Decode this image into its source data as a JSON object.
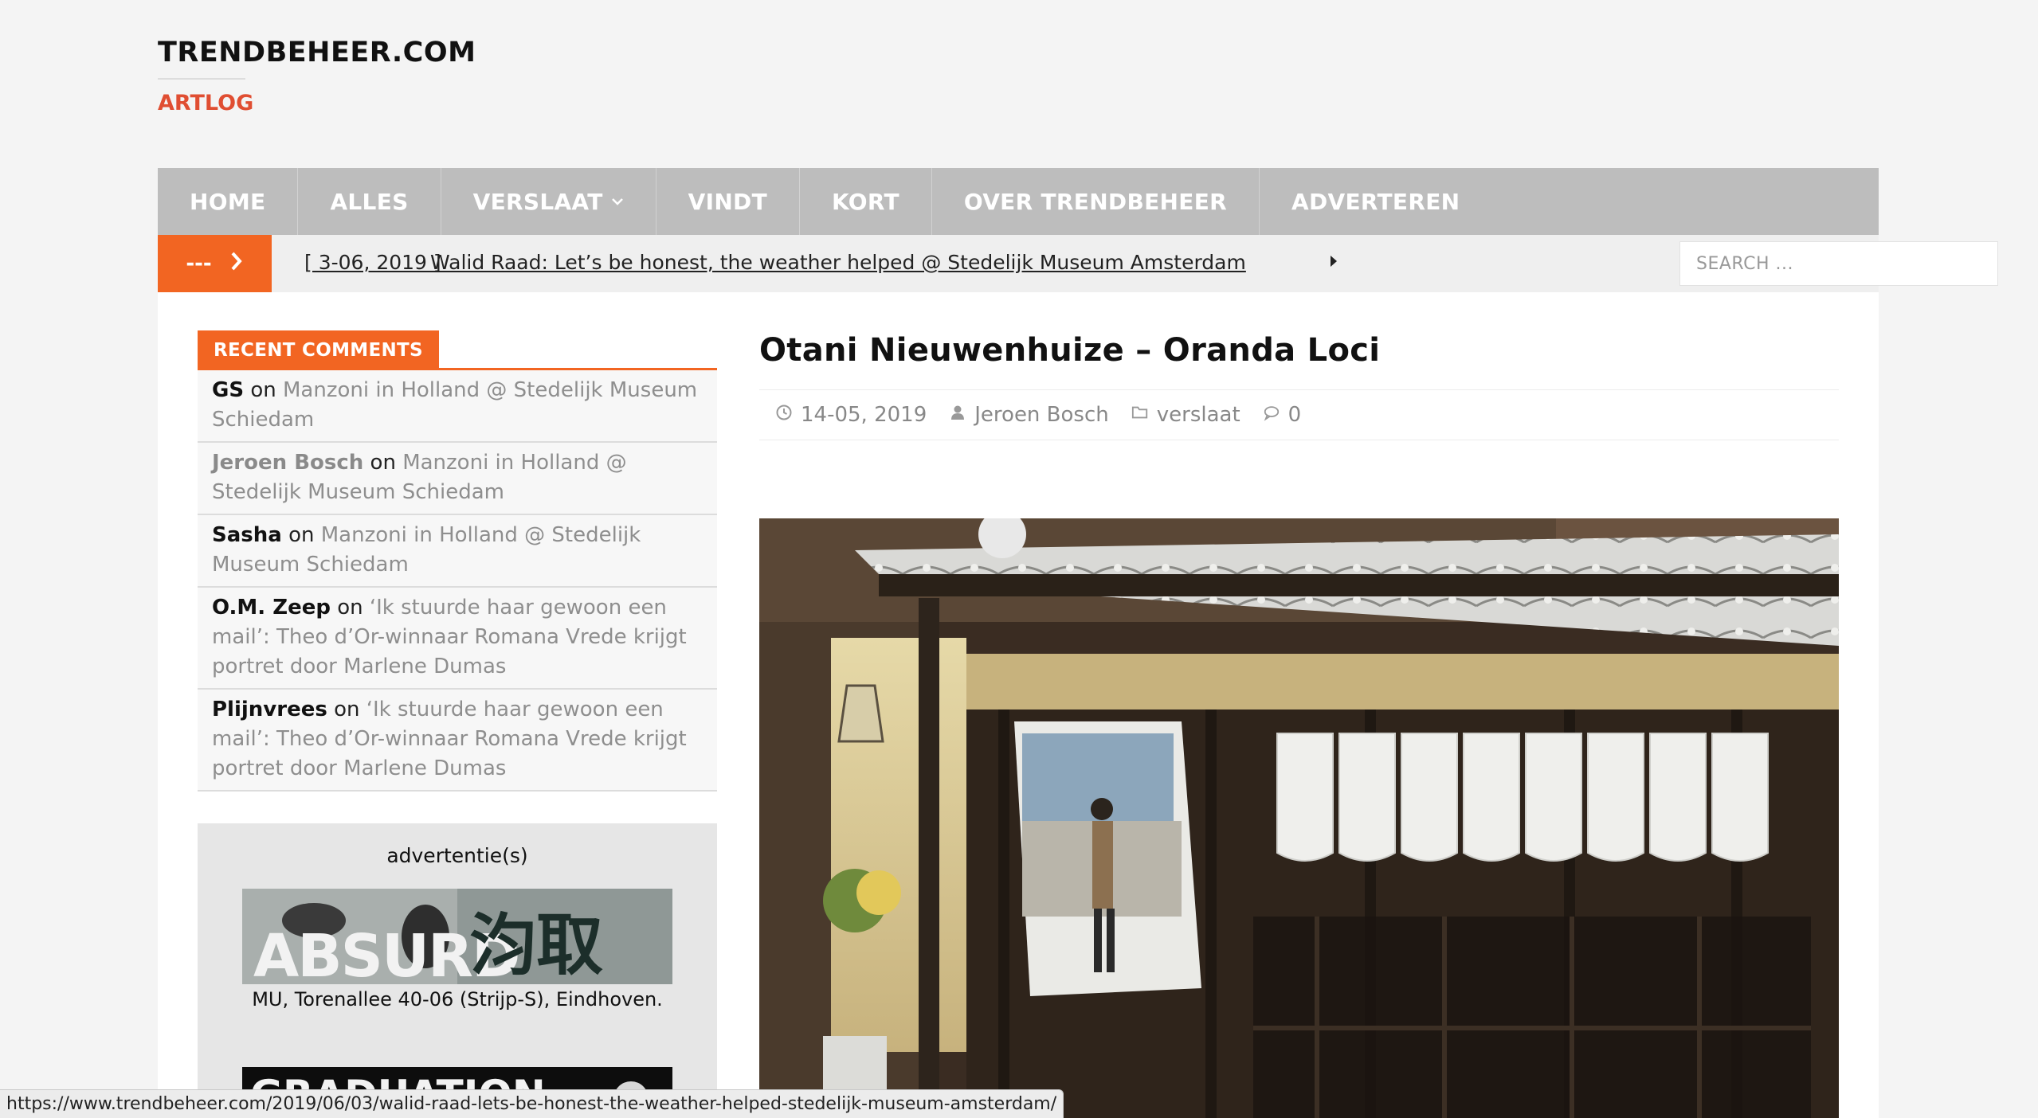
{
  "site": {
    "title": "TRENDBEHEER.COM",
    "tagline": "ARTLOG"
  },
  "nav": {
    "items": [
      "HOME",
      "ALLES",
      "VERSLAAT",
      "VINDT",
      "KORT",
      "OVER TRENDBEHEER",
      "ADVERTEREN"
    ]
  },
  "ticker": {
    "button_label": "---",
    "date": "[ 3-06, 2019 ]",
    "title": "Walid Raad: Let’s be honest, the weather helped @ Stedelijk Museum Amsterdam"
  },
  "search": {
    "placeholder": "SEARCH ..."
  },
  "recent_comments": {
    "title": "RECENT COMMENTS",
    "on_word": "on",
    "items": [
      {
        "author": "GS",
        "post": "Manzoni in Holland @ Stedelijk Museum Schiedam"
      },
      {
        "author": "Jeroen Bosch",
        "post": "Manzoni in Holland @ Stedelijk Museum Schiedam"
      },
      {
        "author": "Sasha",
        "post": "Manzoni in Holland @ Stedelijk Museum Schiedam"
      },
      {
        "author": "O.M. Zeep",
        "post": "‘Ik stuurde haar gewoon een mail’: Theo d’Or-winnaar Romana Vrede krijgt portret door Marlene Dumas"
      },
      {
        "author": "Plijnvrees",
        "post": "‘Ik stuurde haar gewoon een mail’: Theo d’Or-winnaar Romana Vrede krijgt portret door Marlene Dumas"
      }
    ]
  },
  "ad": {
    "title": "advertentie(s)",
    "banner_text": "ABSURD",
    "banner_kanji": "汮取",
    "caption": "MU, Torenallee 40-06 (Strijp-S), Eindhoven.",
    "banner2_text": "GRADUATION"
  },
  "article": {
    "title": "Otani Nieuwenhuize – Oranda Loci",
    "date": "14-05, 2019",
    "author": "Jeroen Bosch",
    "category": "verslaat",
    "comments": "0"
  },
  "status_bar": {
    "url": "https://www.trendbeheer.com/2019/06/03/walid-raad-lets-be-honest-the-weather-helped-stedelijk-museum-amsterdam/"
  },
  "colors": {
    "accent": "#f26522",
    "tagline": "#e04e32",
    "nav_bg": "#bdbdbd"
  }
}
